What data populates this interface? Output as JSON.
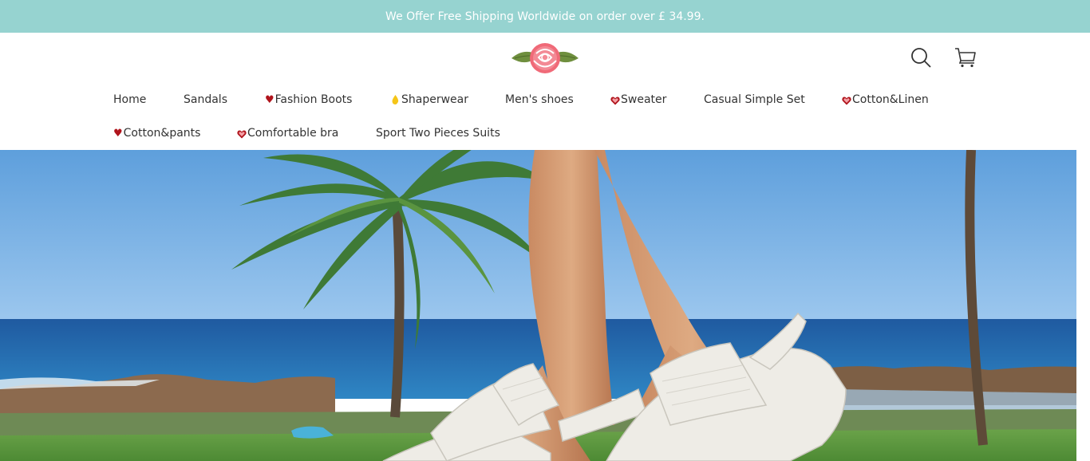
{
  "announcement": {
    "text": "We Offer Free Shipping Worldwide on order over £ 34.99."
  },
  "header": {
    "logo_icon": "rose-logo-icon",
    "search_icon": "search-icon",
    "cart_icon": "cart-icon"
  },
  "nav": {
    "items": [
      {
        "label": "Home",
        "icon": ""
      },
      {
        "label": "Sandals",
        "icon": ""
      },
      {
        "label": "Fashion Boots",
        "icon": "heart-icon"
      },
      {
        "label": "Shaperwear",
        "icon": "drop-icon"
      },
      {
        "label": "Men's shoes",
        "icon": ""
      },
      {
        "label": "Sweater",
        "icon": "heart-outline-icon"
      },
      {
        "label": "Casual Simple Set",
        "icon": ""
      },
      {
        "label": "Cotton&Linen",
        "icon": "heart-outline-icon"
      },
      {
        "label": "Cotton&pants",
        "icon": "heart-icon"
      },
      {
        "label": "Comfortable bra",
        "icon": "heart-outline-icon"
      },
      {
        "label": "Sport Two Pieces Suits",
        "icon": ""
      }
    ]
  },
  "hero": {
    "image": "sandals-beach-hero-image"
  },
  "colors": {
    "announce_bg": "#96d3d0",
    "heart": "#b0141c",
    "drop": "#f5c518"
  }
}
